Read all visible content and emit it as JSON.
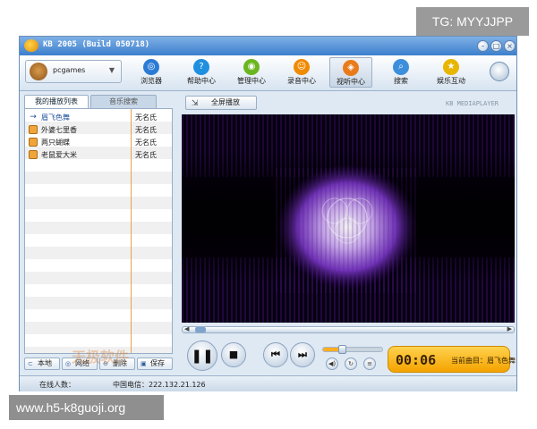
{
  "overlay": {
    "tg_label": "TG: MYYJJPP",
    "site_url": "www.h5-k8guoji.org"
  },
  "window": {
    "title": "KB 2005 (Build 050718)",
    "buttons": [
      "minimize",
      "maximize",
      "close"
    ]
  },
  "user": {
    "name": "pcgames"
  },
  "toolbar": {
    "items": [
      {
        "label": "浏览器",
        "icon": "browser-icon",
        "color": "#2b7bd6"
      },
      {
        "label": "帮助中心",
        "icon": "help-icon",
        "color": "#1f8fe0"
      },
      {
        "label": "管理中心",
        "icon": "manage-icon",
        "color": "#6bb620"
      },
      {
        "label": "录音中心",
        "icon": "record-icon",
        "color": "#f08a00"
      },
      {
        "label": "视听中心",
        "icon": "media-icon",
        "color": "#e97b1a",
        "active": true
      },
      {
        "label": "搜索",
        "icon": "search-icon",
        "color": "#3d8fdc"
      },
      {
        "label": "娱乐互动",
        "icon": "star-icon",
        "color": "#e8b600"
      }
    ]
  },
  "tabs": {
    "playlist": "我的播放列表",
    "music_search": "音乐搜索"
  },
  "playlist": [
    {
      "title": "眉飞色舞",
      "artist": "无名氏",
      "current": true
    },
    {
      "title": "外婆七里香",
      "artist": "无名氏"
    },
    {
      "title": "两只蝴蝶",
      "artist": "无名氏"
    },
    {
      "title": "老鼠爱大米",
      "artist": "无名氏"
    }
  ],
  "playlist_buttons": {
    "local": "本地",
    "network": "网络",
    "delete": "删除",
    "save": "保存"
  },
  "player": {
    "fullscreen_label": "全屏播放",
    "brand": "KB MEDIAPLAYER",
    "elapsed": "00:06",
    "now_playing_label": "当前曲目：眉飞色舞",
    "volume_level": 0.32
  },
  "status": {
    "online_label": "在线人数：",
    "server_label": "中国电信：222.132.21.126"
  },
  "watermark_text": "天极软件"
}
